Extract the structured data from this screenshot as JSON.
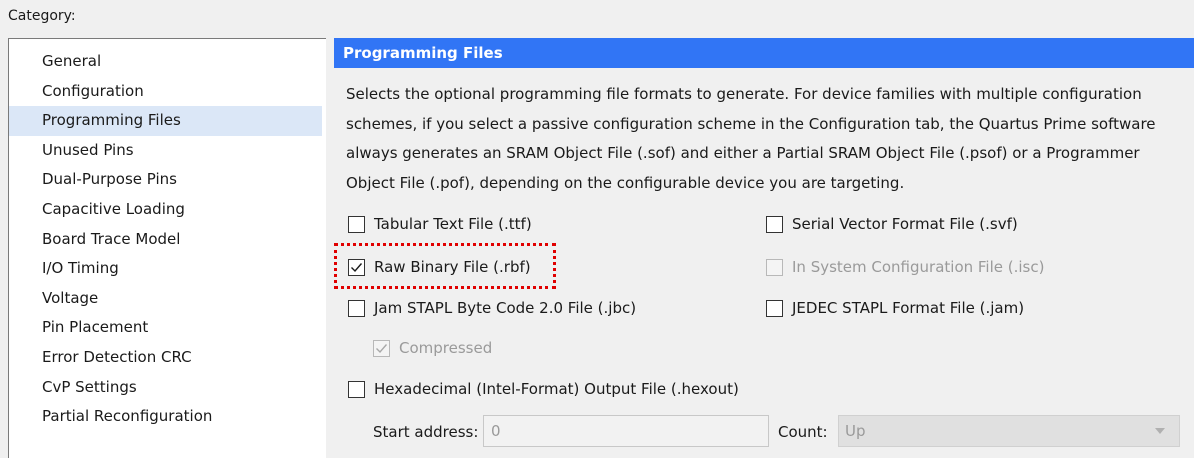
{
  "category_label": "Category:",
  "sidebar": {
    "items": [
      {
        "label": "General"
      },
      {
        "label": "Configuration"
      },
      {
        "label": "Programming Files",
        "selected": true
      },
      {
        "label": "Unused Pins"
      },
      {
        "label": "Dual-Purpose Pins"
      },
      {
        "label": "Capacitive Loading"
      },
      {
        "label": "Board Trace Model"
      },
      {
        "label": "I/O Timing"
      },
      {
        "label": "Voltage"
      },
      {
        "label": "Pin Placement"
      },
      {
        "label": "Error Detection CRC"
      },
      {
        "label": "CvP Settings"
      },
      {
        "label": "Partial Reconfiguration"
      }
    ]
  },
  "panel": {
    "title": "Programming Files",
    "description": "Selects the optional programming file formats to generate. For device families with multiple configuration schemes, if you select a passive configuration scheme in the Configuration tab, the Quartus Prime software always generates an SRAM Object File (.sof) and either a Partial SRAM Object File (.psof) or a Programmer Object File (.pof), depending on the configurable device you are targeting.",
    "options": {
      "ttf": {
        "label": "Tabular Text File (.ttf)",
        "checked": false,
        "enabled": true
      },
      "svf": {
        "label": "Serial Vector Format File (.svf)",
        "checked": false,
        "enabled": true
      },
      "rbf": {
        "label": "Raw Binary File (.rbf)",
        "checked": true,
        "enabled": true
      },
      "isc": {
        "label": "In System Configuration File (.isc)",
        "checked": false,
        "enabled": false
      },
      "jbc": {
        "label": "Jam STAPL Byte Code 2.0 File (.jbc)",
        "checked": false,
        "enabled": true
      },
      "jam": {
        "label": "JEDEC STAPL Format File (.jam)",
        "checked": false,
        "enabled": true
      },
      "compressed": {
        "label": "Compressed",
        "checked": true,
        "enabled": false
      },
      "hexout": {
        "label": "Hexadecimal (Intel-Format) Output File (.hexout)",
        "checked": false,
        "enabled": true
      }
    },
    "start_address": {
      "label": "Start address:",
      "value": "0"
    },
    "count": {
      "label": "Count:",
      "value": "Up"
    }
  },
  "colors": {
    "header_bg": "#3175f5",
    "selection_bg": "#dbe7f7",
    "highlight": "#e00000"
  }
}
